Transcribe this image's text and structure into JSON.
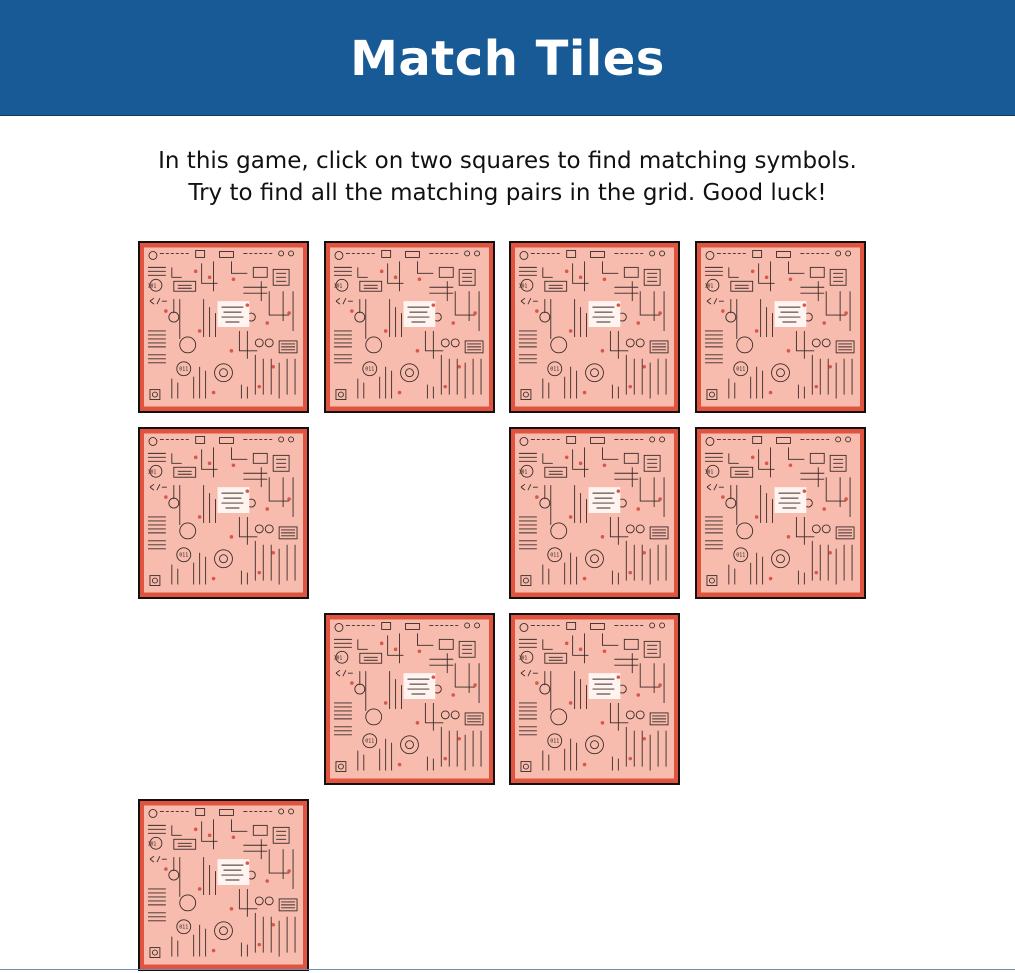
{
  "header": {
    "title": "Match Tiles"
  },
  "instructions": {
    "line1": "In this game, click on two squares to find matching symbols.",
    "line2": "Try to find all the matching pairs in the grid. Good luck!"
  },
  "colors": {
    "header_bg": "#185a95",
    "tile_border": "#e0533f",
    "tile_face": "#f7bcae",
    "circuit_ink": "#3a2a28"
  },
  "board": {
    "columns": 4,
    "rows": 4,
    "tiles": [
      {
        "id": "tile-1-1",
        "state": "hidden"
      },
      {
        "id": "tile-1-2",
        "state": "hidden"
      },
      {
        "id": "tile-1-3",
        "state": "hidden"
      },
      {
        "id": "tile-1-4",
        "state": "hidden"
      },
      {
        "id": "tile-2-1",
        "state": "hidden"
      },
      {
        "id": "tile-2-2",
        "state": "removed"
      },
      {
        "id": "tile-2-3",
        "state": "hidden"
      },
      {
        "id": "tile-2-4",
        "state": "hidden"
      },
      {
        "id": "tile-3-1",
        "state": "removed"
      },
      {
        "id": "tile-3-2",
        "state": "hidden"
      },
      {
        "id": "tile-3-3",
        "state": "hidden"
      },
      {
        "id": "tile-3-4",
        "state": "removed"
      },
      {
        "id": "tile-4-1",
        "state": "hidden"
      },
      {
        "id": "tile-4-2",
        "state": "removed"
      },
      {
        "id": "tile-4-3",
        "state": "removed"
      },
      {
        "id": "tile-4-4",
        "state": "removed"
      }
    ]
  }
}
